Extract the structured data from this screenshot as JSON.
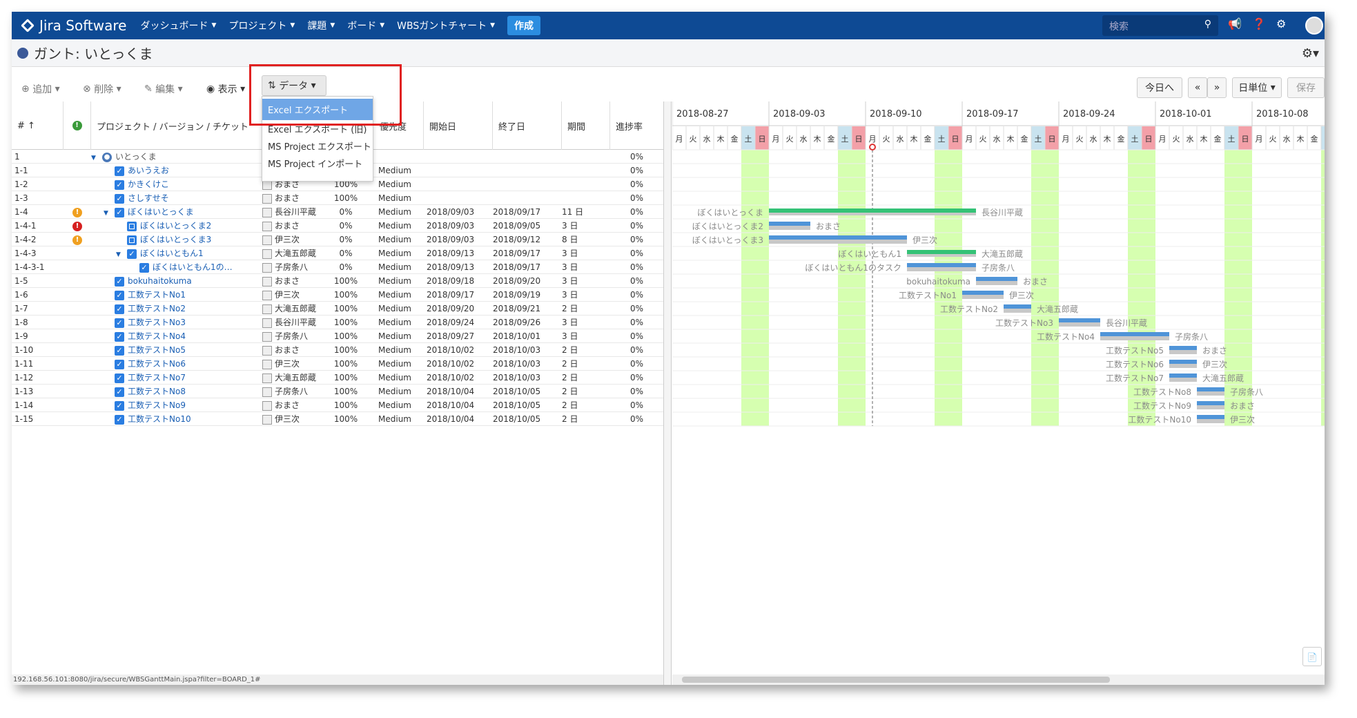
{
  "header": {
    "logo": "Jira Software",
    "nav": [
      {
        "label": "ダッシュボード"
      },
      {
        "label": "プロジェクト"
      },
      {
        "label": "課題"
      },
      {
        "label": "ボード"
      },
      {
        "label": "WBSガントチャート"
      }
    ],
    "create": "作成",
    "search_placeholder": "検索"
  },
  "page": {
    "title": "ガント: いとっくま"
  },
  "toolbar": {
    "add": "追加",
    "delete": "削除",
    "edit": "編集",
    "view": "表示",
    "data": "データ",
    "today": "今日へ",
    "prev": "«",
    "next": "»",
    "unit": "日単位",
    "save": "保存"
  },
  "data_menu": [
    {
      "label": "Excel エクスポート",
      "selected": true
    },
    {
      "label": "Excel エクスポート (旧)"
    },
    {
      "label": "MS Project エクスポート"
    },
    {
      "label": "MS Project インポート"
    }
  ],
  "columns": {
    "num": "#",
    "project": "プロジェクト / バージョン / チケット",
    "priority": "優先度",
    "start": "開始日",
    "end": "終了日",
    "duration": "期間",
    "progress": "進捗率"
  },
  "rows": [
    {
      "id": "1",
      "indent": 0,
      "type": "project",
      "name": "いとっくま",
      "warn": "",
      "user": "",
      "pct": "",
      "pri": "",
      "start": "",
      "end": "",
      "dur": "",
      "prog": "0%"
    },
    {
      "id": "1-1",
      "indent": 1,
      "type": "check",
      "name": "あいうえお",
      "warn": "",
      "user": "",
      "pct": "",
      "pri": "Medium",
      "start": "",
      "end": "",
      "dur": "",
      "prog": "0%"
    },
    {
      "id": "1-2",
      "indent": 1,
      "type": "check",
      "name": "かきくけこ",
      "warn": "",
      "user": "おまさ",
      "pct": "100%",
      "pri": "Medium",
      "start": "",
      "end": "",
      "dur": "",
      "prog": "0%"
    },
    {
      "id": "1-3",
      "indent": 1,
      "type": "check",
      "name": "さしすせそ",
      "warn": "",
      "user": "おまさ",
      "pct": "100%",
      "pri": "Medium",
      "start": "",
      "end": "",
      "dur": "",
      "prog": "0%"
    },
    {
      "id": "1-4",
      "indent": 1,
      "type": "check",
      "toggle": true,
      "name": "ぼくはいとっくま",
      "warn": "o",
      "user": "長谷川平蔵",
      "pct": "0%",
      "pri": "Medium",
      "start": "2018/09/03",
      "end": "2018/09/17",
      "dur": "11 日",
      "prog": "0%"
    },
    {
      "id": "1-4-1",
      "indent": 2,
      "type": "sub",
      "name": "ぼくはいとっくま2",
      "warn": "r",
      "user": "おまさ",
      "pct": "0%",
      "pri": "Medium",
      "start": "2018/09/03",
      "end": "2018/09/05",
      "dur": "3 日",
      "prog": "0%"
    },
    {
      "id": "1-4-2",
      "indent": 2,
      "type": "sub",
      "name": "ぼくはいとっくま3",
      "warn": "o",
      "user": "伊三次",
      "pct": "0%",
      "pri": "Medium",
      "start": "2018/09/03",
      "end": "2018/09/12",
      "dur": "8 日",
      "prog": "0%"
    },
    {
      "id": "1-4-3",
      "indent": 2,
      "type": "check",
      "toggle": true,
      "name": "ぼくはいともん1",
      "warn": "",
      "user": "大滝五郎蔵",
      "pct": "0%",
      "pri": "Medium",
      "start": "2018/09/13",
      "end": "2018/09/17",
      "dur": "3 日",
      "prog": "0%"
    },
    {
      "id": "1-4-3-1",
      "indent": 3,
      "type": "check",
      "name": "ぼくはいともん1の…",
      "warn": "",
      "user": "子房条八",
      "pct": "0%",
      "pri": "Medium",
      "start": "2018/09/13",
      "end": "2018/09/17",
      "dur": "3 日",
      "prog": "0%"
    },
    {
      "id": "1-5",
      "indent": 1,
      "type": "check",
      "name": "bokuhaitokuma",
      "warn": "",
      "user": "おまさ",
      "pct": "100%",
      "pri": "Medium",
      "start": "2018/09/18",
      "end": "2018/09/20",
      "dur": "3 日",
      "prog": "0%"
    },
    {
      "id": "1-6",
      "indent": 1,
      "type": "check",
      "name": "工数テストNo1",
      "warn": "",
      "user": "伊三次",
      "pct": "100%",
      "pri": "Medium",
      "start": "2018/09/17",
      "end": "2018/09/19",
      "dur": "3 日",
      "prog": "0%"
    },
    {
      "id": "1-7",
      "indent": 1,
      "type": "check",
      "name": "工数テストNo2",
      "warn": "",
      "user": "大滝五郎蔵",
      "pct": "100%",
      "pri": "Medium",
      "start": "2018/09/20",
      "end": "2018/09/21",
      "dur": "2 日",
      "prog": "0%"
    },
    {
      "id": "1-8",
      "indent": 1,
      "type": "check",
      "name": "工数テストNo3",
      "warn": "",
      "user": "長谷川平蔵",
      "pct": "100%",
      "pri": "Medium",
      "start": "2018/09/24",
      "end": "2018/09/26",
      "dur": "3 日",
      "prog": "0%"
    },
    {
      "id": "1-9",
      "indent": 1,
      "type": "check",
      "name": "工数テストNo4",
      "warn": "",
      "user": "子房条八",
      "pct": "100%",
      "pri": "Medium",
      "start": "2018/09/27",
      "end": "2018/10/01",
      "dur": "3 日",
      "prog": "0%"
    },
    {
      "id": "1-10",
      "indent": 1,
      "type": "check",
      "name": "工数テストNo5",
      "warn": "",
      "user": "おまさ",
      "pct": "100%",
      "pri": "Medium",
      "start": "2018/10/02",
      "end": "2018/10/03",
      "dur": "2 日",
      "prog": "0%"
    },
    {
      "id": "1-11",
      "indent": 1,
      "type": "check",
      "name": "工数テストNo6",
      "warn": "",
      "user": "伊三次",
      "pct": "100%",
      "pri": "Medium",
      "start": "2018/10/02",
      "end": "2018/10/03",
      "dur": "2 日",
      "prog": "0%"
    },
    {
      "id": "1-12",
      "indent": 1,
      "type": "check",
      "name": "工数テストNo7",
      "warn": "",
      "user": "大滝五郎蔵",
      "pct": "100%",
      "pri": "Medium",
      "start": "2018/10/02",
      "end": "2018/10/03",
      "dur": "2 日",
      "prog": "0%"
    },
    {
      "id": "1-13",
      "indent": 1,
      "type": "check",
      "name": "工数テストNo8",
      "warn": "",
      "user": "子房条八",
      "pct": "100%",
      "pri": "Medium",
      "start": "2018/10/04",
      "end": "2018/10/05",
      "dur": "2 日",
      "prog": "0%"
    },
    {
      "id": "1-14",
      "indent": 1,
      "type": "check",
      "name": "工数テストNo9",
      "warn": "",
      "user": "おまさ",
      "pct": "100%",
      "pri": "Medium",
      "start": "2018/10/04",
      "end": "2018/10/05",
      "dur": "2 日",
      "prog": "0%"
    },
    {
      "id": "1-15",
      "indent": 1,
      "type": "check",
      "name": "工数テストNo10",
      "warn": "",
      "user": "伊三次",
      "pct": "100%",
      "pri": "Medium",
      "start": "2018/10/04",
      "end": "2018/10/05",
      "dur": "2 日",
      "prog": "0%"
    }
  ],
  "gantt": {
    "first_date": "2018-08-27",
    "weeks": [
      "2018-08-27",
      "2018-09-03",
      "2018-09-10",
      "2018-09-17",
      "2018-09-24",
      "2018-10-01",
      "2018-10-08"
    ],
    "day_labels": [
      "月",
      "火",
      "水",
      "木",
      "金",
      "土",
      "日"
    ],
    "today": "2018-09-10",
    "bars": [
      {
        "row": 4,
        "start": "2018-09-03",
        "end": "2018-09-17",
        "kind": "summary",
        "label": "ぼくはいとっくま",
        "user": "長谷川平蔵"
      },
      {
        "row": 5,
        "start": "2018-09-03",
        "end": "2018-09-05",
        "kind": "task",
        "label": "ぼくはいとっくま2",
        "user": "おまさ"
      },
      {
        "row": 6,
        "start": "2018-09-03",
        "end": "2018-09-12",
        "kind": "task",
        "label": "ぼくはいとっくま3",
        "user": "伊三次"
      },
      {
        "row": 7,
        "start": "2018-09-13",
        "end": "2018-09-17",
        "kind": "summary",
        "label": "ぼくはいともん1",
        "user": "大滝五郎蔵"
      },
      {
        "row": 8,
        "start": "2018-09-13",
        "end": "2018-09-17",
        "kind": "task",
        "label": "ぼくはいともん1のタスク",
        "user": "子房条八"
      },
      {
        "row": 9,
        "start": "2018-09-18",
        "end": "2018-09-20",
        "kind": "task",
        "label": "bokuhaitokuma",
        "user": "おまさ"
      },
      {
        "row": 10,
        "start": "2018-09-17",
        "end": "2018-09-19",
        "kind": "task",
        "label": "工数テストNo1",
        "user": "伊三次"
      },
      {
        "row": 11,
        "start": "2018-09-20",
        "end": "2018-09-21",
        "kind": "task",
        "label": "工数テストNo2",
        "user": "大滝五郎蔵"
      },
      {
        "row": 12,
        "start": "2018-09-24",
        "end": "2018-09-26",
        "kind": "task",
        "label": "工数テストNo3",
        "user": "長谷川平蔵"
      },
      {
        "row": 13,
        "start": "2018-09-27",
        "end": "2018-10-01",
        "kind": "task",
        "label": "工数テストNo4",
        "user": "子房条八"
      },
      {
        "row": 14,
        "start": "2018-10-02",
        "end": "2018-10-03",
        "kind": "task",
        "label": "工数テストNo5",
        "user": "おまさ"
      },
      {
        "row": 15,
        "start": "2018-10-02",
        "end": "2018-10-03",
        "kind": "task",
        "label": "工数テストNo6",
        "user": "伊三次"
      },
      {
        "row": 16,
        "start": "2018-10-02",
        "end": "2018-10-03",
        "kind": "task",
        "label": "工数テストNo7",
        "user": "大滝五郎蔵"
      },
      {
        "row": 17,
        "start": "2018-10-04",
        "end": "2018-10-05",
        "kind": "task",
        "label": "工数テストNo8",
        "user": "子房条八"
      },
      {
        "row": 18,
        "start": "2018-10-04",
        "end": "2018-10-05",
        "kind": "task",
        "label": "工数テストNo9",
        "user": "おまさ"
      },
      {
        "row": 19,
        "start": "2018-10-04",
        "end": "2018-10-05",
        "kind": "task",
        "label": "工数テストNo10",
        "user": "伊三次"
      }
    ],
    "colors": {
      "weekend": "#d6ffb0",
      "sat_head": "#c9e3ef",
      "sun_head": "#f3a0a8",
      "summary": "#34c276",
      "task": "#4f94d8",
      "shadow": "#c8c8c8",
      "label": "#8a8a8a"
    }
  },
  "status_url": "192.168.56.101:8080/jira/secure/WBSGanttMain.jspa?filter=BOARD_1#"
}
